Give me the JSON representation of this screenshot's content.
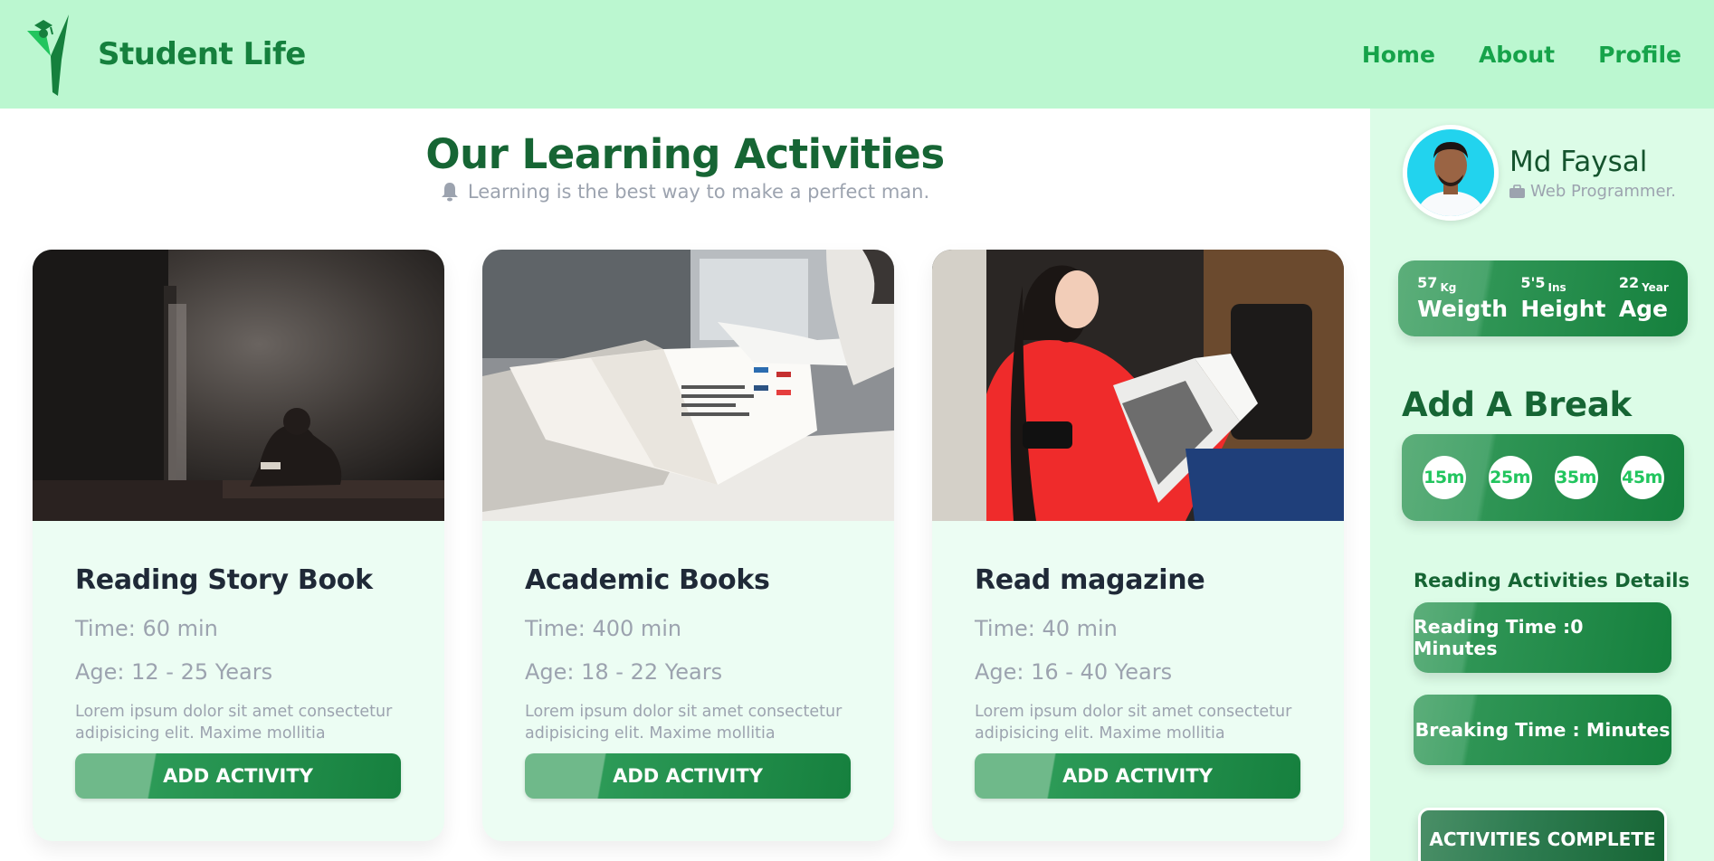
{
  "header": {
    "brand": "Student Life",
    "nav": [
      "Home",
      "About",
      "Profile"
    ]
  },
  "main": {
    "title": "Our Learning Activities",
    "subtitle": "Learning is the best way to make a perfect man.",
    "cards": [
      {
        "title": "Reading Story Book",
        "time": "Time: 60 min",
        "age": "Age: 12 - 25 Years",
        "description": "Lorem ipsum dolor sit amet consectetur adipisicing elit. Maxime mollitia",
        "button": "ADD ACTIVITY"
      },
      {
        "title": "Academic Books",
        "time": "Time: 400 min",
        "age": "Age: 18 - 22 Years",
        "description": "Lorem ipsum dolor sit amet consectetur adipisicing elit. Maxime mollitia",
        "button": "ADD ACTIVITY"
      },
      {
        "title": "Read magazine",
        "time": "Time: 40 min",
        "age": "Age: 16 - 40 Years",
        "description": "Lorem ipsum dolor sit amet consectetur adipisicing elit. Maxime mollitia",
        "button": "ADD ACTIVITY"
      }
    ]
  },
  "sidebar": {
    "profile": {
      "name": "Md Faysal",
      "role": "Web Programmer."
    },
    "stats": [
      {
        "value": "57",
        "unit": "Kg",
        "label": "Weigth"
      },
      {
        "value": "5'5",
        "unit": "Ins",
        "label": "Height"
      },
      {
        "value": "22",
        "unit": "Year",
        "label": "Age"
      }
    ],
    "break_title": "Add A Break",
    "breaks": [
      "15m",
      "25m",
      "35m",
      "45m"
    ],
    "details_title": "Reading Activities Details",
    "reading_time": "Reading Time :0 Minutes",
    "breaking_time": "Breaking Time : Minutes",
    "complete_button": "ACTIVITIES COMPLETE"
  },
  "colors": {
    "header_bg": "#bbf7d0",
    "sidebar_bg": "#dcfce7",
    "card_bg": "#ecfdf3",
    "brand_green": "#15803d",
    "title_green": "#166534"
  },
  "icons": [
    "student-logo-icon",
    "bell-icon",
    "briefcase-icon"
  ]
}
